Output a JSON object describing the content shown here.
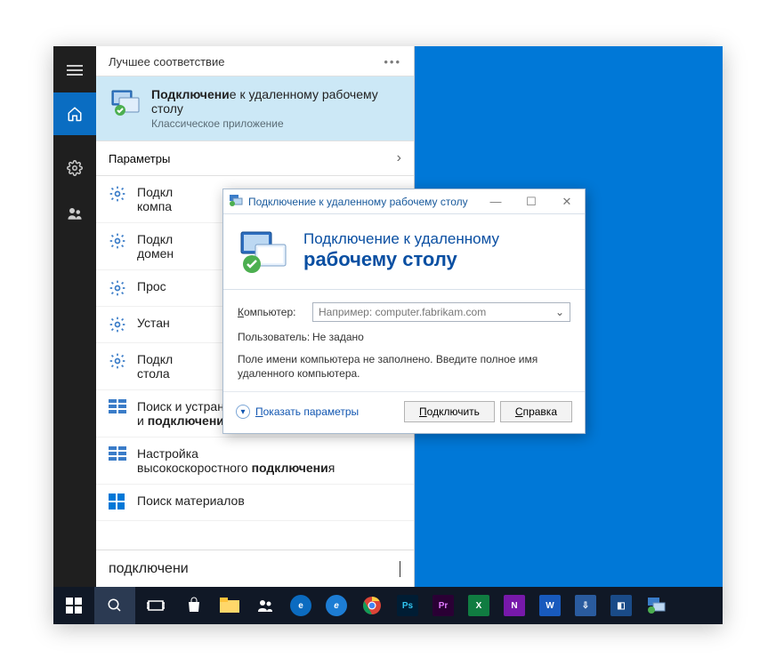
{
  "start": {
    "best_match_header": "Лучшее соответствие",
    "best_match_title_pre": "Подключени",
    "best_match_title_rest": "е к удаленному рабочему столу",
    "best_match_sub": "Классическое приложение",
    "params_header": "Параметры",
    "results": [
      {
        "line1_pre": "Подкл",
        "line1_rest": "",
        "line2": "компа"
      },
      {
        "line1_pre": "Подкл",
        "line1_rest": "",
        "line2": "домен"
      },
      {
        "line1_pre": "Прос",
        "line1_rest": "",
        "line2": ""
      },
      {
        "line1_pre": "Устан",
        "line1_rest": "",
        "line2": ""
      },
      {
        "line1_pre": "Подкл",
        "line1_rest": "",
        "line2": "стола"
      },
      {
        "line1_pre": "Поиск и устранение проблем с сетью",
        "line1_rest": "",
        "line2_pre": "и ",
        "line2_bold": "подключени",
        "line2_rest": "ем"
      },
      {
        "line1_pre": "Настройка",
        "line1_rest": "",
        "line2_pre": "высокоскоростного ",
        "line2_bold": "подключени",
        "line2_rest": "я"
      },
      {
        "line1_pre": "Поиск материалов",
        "line1_rest": "",
        "line2": ""
      }
    ],
    "search_value": "подключени"
  },
  "rdp": {
    "window_title": "Подключение к удаленному рабочему столу",
    "header_line1": "Подключение к удаленному",
    "header_line2": "рабочему столу",
    "label_computer": "Компьютер:",
    "placeholder_computer": "Например: computer.fabrikam.com",
    "label_user": "Пользователь:",
    "user_value": "Не задано",
    "msg": "Поле имени компьютера не заполнено. Введите полное имя удаленного компьютера.",
    "show_params": "Показать параметры",
    "btn_connect": "Подключить",
    "btn_help": "Справка"
  },
  "taskbar": {
    "apps": [
      "start",
      "search",
      "taskview",
      "store",
      "folder",
      "people",
      "edge",
      "ie",
      "chrome",
      "ps",
      "pr",
      "excel",
      "onenote",
      "word",
      "jd",
      "tm",
      "rdp"
    ]
  }
}
